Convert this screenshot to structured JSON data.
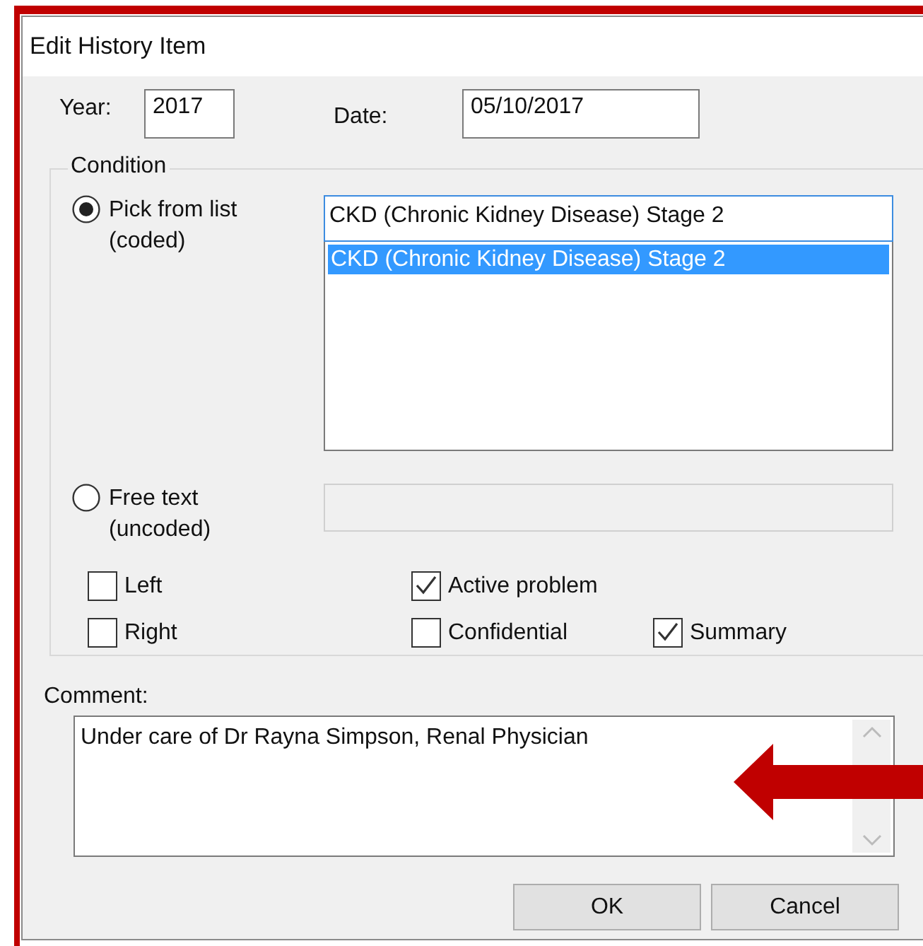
{
  "window": {
    "title": "Edit History Item"
  },
  "year": {
    "label": "Year:",
    "value": "2017"
  },
  "date": {
    "label": "Date:",
    "value": "05/10/2017"
  },
  "condition": {
    "legend": "Condition",
    "options": [
      {
        "label": "Pick from list",
        "sublabel": "(coded)",
        "selected": true
      },
      {
        "label": "Free text",
        "sublabel": "(uncoded)",
        "selected": false
      }
    ],
    "combo_value": "CKD (Chronic Kidney Disease) Stage 2",
    "list_items": [
      {
        "text": "CKD (Chronic Kidney Disease) Stage 2",
        "selected": true
      }
    ],
    "free_text": {
      "disabled": true
    },
    "checkboxes": [
      {
        "label": "Left",
        "checked": false
      },
      {
        "label": "Right",
        "checked": false
      },
      {
        "label": "Active problem",
        "checked": true
      },
      {
        "label": "Confidential",
        "checked": false
      },
      {
        "label": "Summary",
        "checked": true
      }
    ]
  },
  "comment": {
    "label": "Comment:",
    "value": "Under care of Dr Rayna Simpson, Renal Physician"
  },
  "buttons": [
    "OK",
    "Cancel"
  ]
}
